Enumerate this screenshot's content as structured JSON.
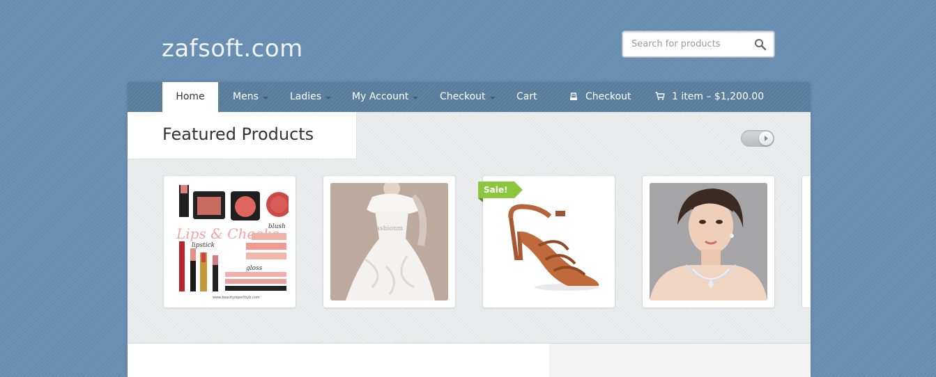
{
  "site": {
    "title": "zafsoft.com"
  },
  "search": {
    "placeholder": "Search for products"
  },
  "nav": {
    "items": [
      {
        "label": "Home",
        "active": true,
        "dropdown": false
      },
      {
        "label": "Mens",
        "dropdown": true
      },
      {
        "label": "Ladies",
        "dropdown": true
      },
      {
        "label": "My Account",
        "dropdown": true
      },
      {
        "label": "Checkout",
        "dropdown": true
      },
      {
        "label": "Cart",
        "dropdown": false
      }
    ],
    "checkout_label": "Checkout",
    "cart_summary": "1 item – $1,200.00"
  },
  "featured": {
    "title": "Featured Products",
    "products": [
      {
        "image": "cosmetics-collage"
      },
      {
        "image": "white-wedding-dress"
      },
      {
        "image": "brown-strappy-sandal",
        "badge": "Sale!"
      },
      {
        "image": "woman-with-necklace"
      }
    ]
  },
  "colors": {
    "background": "#6a8fb3",
    "nav": "#5b7f9f",
    "sale_badge": "#8cc63e"
  }
}
